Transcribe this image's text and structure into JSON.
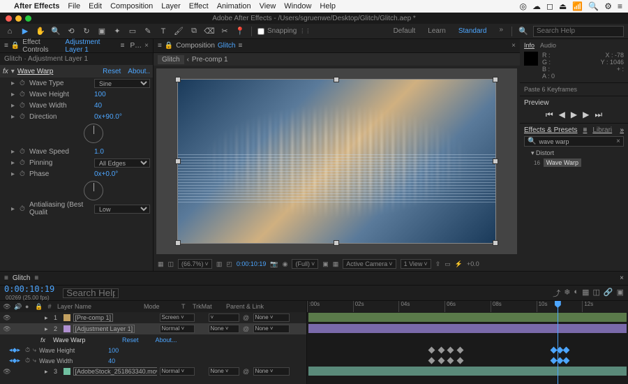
{
  "menubar": {
    "apple": "",
    "items": [
      "After Effects",
      "File",
      "Edit",
      "Composition",
      "Layer",
      "Effect",
      "Animation",
      "View",
      "Window",
      "Help"
    ],
    "status_icons": [
      "◎",
      "☁",
      "◻",
      "⏏",
      "📶",
      "🔍",
      "⚙",
      "≡"
    ]
  },
  "window": {
    "title": "Adobe After Effects - /Users/sgruenwe/Desktop/Glitch/Glitch.aep *"
  },
  "toolbar": {
    "snapping": "Snapping",
    "workspaces": [
      "Default",
      "Learn",
      "Standard"
    ],
    "active_ws": "Standard",
    "search_ph": "Search Help"
  },
  "left": {
    "tab_prefix": "Effect Controls",
    "tab_layer": "Adjustment Layer 1",
    "context": "Glitch · Adjustment Layer 1",
    "fx": {
      "name": "Wave Warp",
      "reset": "Reset",
      "about": "About..",
      "fx_label": "fx",
      "params": [
        {
          "label": "Wave Type",
          "val": "Sine",
          "type": "select"
        },
        {
          "label": "Wave Height",
          "val": "100",
          "type": "num"
        },
        {
          "label": "Wave Width",
          "val": "40",
          "type": "num"
        },
        {
          "label": "Direction",
          "val": "0x+90.0°",
          "type": "dial"
        },
        {
          "label": "Wave Speed",
          "val": "1.0",
          "type": "num"
        },
        {
          "label": "Pinning",
          "val": "All Edges",
          "type": "select"
        },
        {
          "label": "Phase",
          "val": "0x+0.0°",
          "type": "dial"
        },
        {
          "label": "Antialiasing (Best Qualit",
          "val": "Low",
          "type": "select"
        }
      ]
    }
  },
  "center": {
    "tab": "Composition",
    "comp": "Glitch",
    "crumbs": [
      "Glitch",
      "Pre-comp 1"
    ],
    "footer": {
      "zoom": "(66.7%)",
      "tc": "0:00:10:19",
      "res": "(Full)",
      "camera": "Active Camera",
      "views": "1 View"
    }
  },
  "right": {
    "info": {
      "tabs": [
        "Info",
        "Audio"
      ],
      "R": "R :",
      "G": "G :",
      "B": "B :",
      "A": "A : 0",
      "X": "X : -78",
      "Y": "Y : 1046",
      "plus": "+ :"
    },
    "action": "Paste 6 Keyframes",
    "preview": "Preview",
    "effects": {
      "tabs": [
        "Effects & Presets",
        "Librari"
      ],
      "search": "wave warp",
      "folder": "Distort",
      "item": "Wave Warp",
      "item_badge": "16"
    }
  },
  "timeline": {
    "comp": "Glitch",
    "tc": "0:00:10:19",
    "tc_sub": "00269 (25.00 fps)",
    "cols": {
      "layer_name": "Layer Name",
      "mode": "Mode",
      "trkmat": "TrkMat",
      "parent": "Parent & Link",
      "t": "T"
    },
    "layers": [
      {
        "idx": "1",
        "name": "[Pre-comp 1]",
        "mode": "Screen",
        "trkmat": "",
        "parent": "None",
        "color": "#c2a060"
      },
      {
        "idx": "2",
        "name": "[Adjustment Layer 1]",
        "mode": "Normal",
        "trkmat": "None",
        "parent": "None",
        "color": "#b090d0",
        "sel": true,
        "fx": {
          "name": "Wave Warp",
          "reset": "Reset",
          "about": "About...",
          "params": [
            {
              "name": "Wave Height",
              "val": "100"
            },
            {
              "name": "Wave Width",
              "val": "40"
            }
          ]
        }
      },
      {
        "idx": "3",
        "name": "[AdobeStock_251863340.mov]",
        "mode": "Normal",
        "trkmat": "None",
        "parent": "None",
        "color": "#70c0a0"
      }
    ],
    "ruler": [
      ":00s",
      "02s",
      "04s",
      "06s",
      "08s",
      "10s",
      "12s"
    ]
  }
}
